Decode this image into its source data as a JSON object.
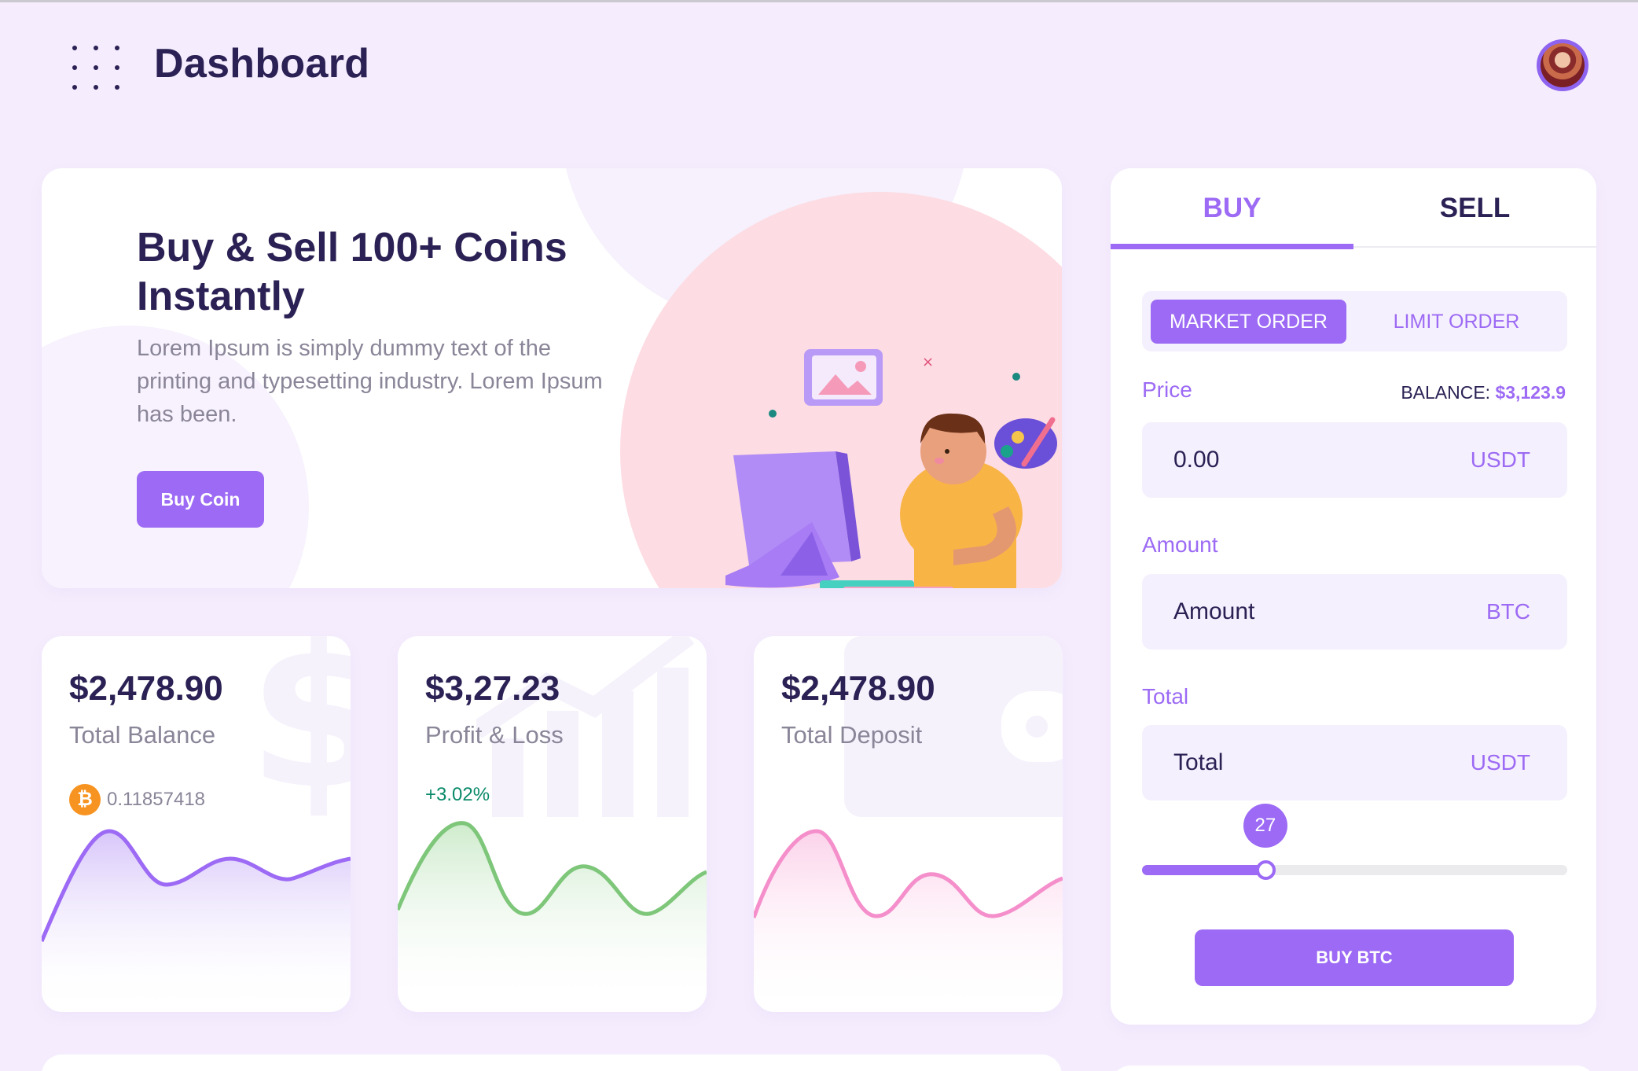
{
  "header": {
    "title": "Dashboard",
    "menu_icon": "grid-dots-icon",
    "avatar_icon": "user-avatar"
  },
  "hero": {
    "title": "Buy & Sell 100+ Coins Instantly",
    "description": "Lorem Ipsum is simply dummy text of the printing and typesetting industry. Lorem Ipsum has been.",
    "button_label": "Buy Coin",
    "illustration": "person-at-computer-illustration"
  },
  "stats": [
    {
      "value": "$2,478.90",
      "label": "Total Balance",
      "sub_icon": "bitcoin-icon",
      "sub_icon_glyph": "₿",
      "sub_text": "0.11857418",
      "color": "#9c6af4",
      "watermark": "dollar-sign-icon"
    },
    {
      "value": "$3,27.23",
      "label": "Profit & Loss",
      "sub_text": "+3.02%",
      "color": "#7ec77a",
      "watermark": "growth-chart-icon"
    },
    {
      "value": "$2,478.90",
      "label": "Total Deposit",
      "color": "#f58fcb",
      "watermark": "wallet-icon"
    }
  ],
  "trade": {
    "tabs": [
      "BUY",
      "SELL"
    ],
    "active_tab": "BUY",
    "order_types": [
      "MARKET ORDER",
      "LIMIT ORDER"
    ],
    "active_order_type": "MARKET ORDER",
    "price_label": "Price",
    "balance_label": "BALANCE:",
    "balance_value": "$3,123.9",
    "price_value": "0.00",
    "price_unit": "USDT",
    "amount_label": "Amount",
    "amount_value": "Amount",
    "amount_unit": "BTC",
    "total_label": "Total",
    "total_value": "Total",
    "total_unit": "USDT",
    "slider_value": "27",
    "slider_fraction": 0.29,
    "submit_label": "BUY BTC"
  },
  "colors": {
    "accent": "#9c6af4",
    "background": "#f5edfd",
    "text_dark": "#2b2154",
    "positive": "#0a8a6a"
  }
}
